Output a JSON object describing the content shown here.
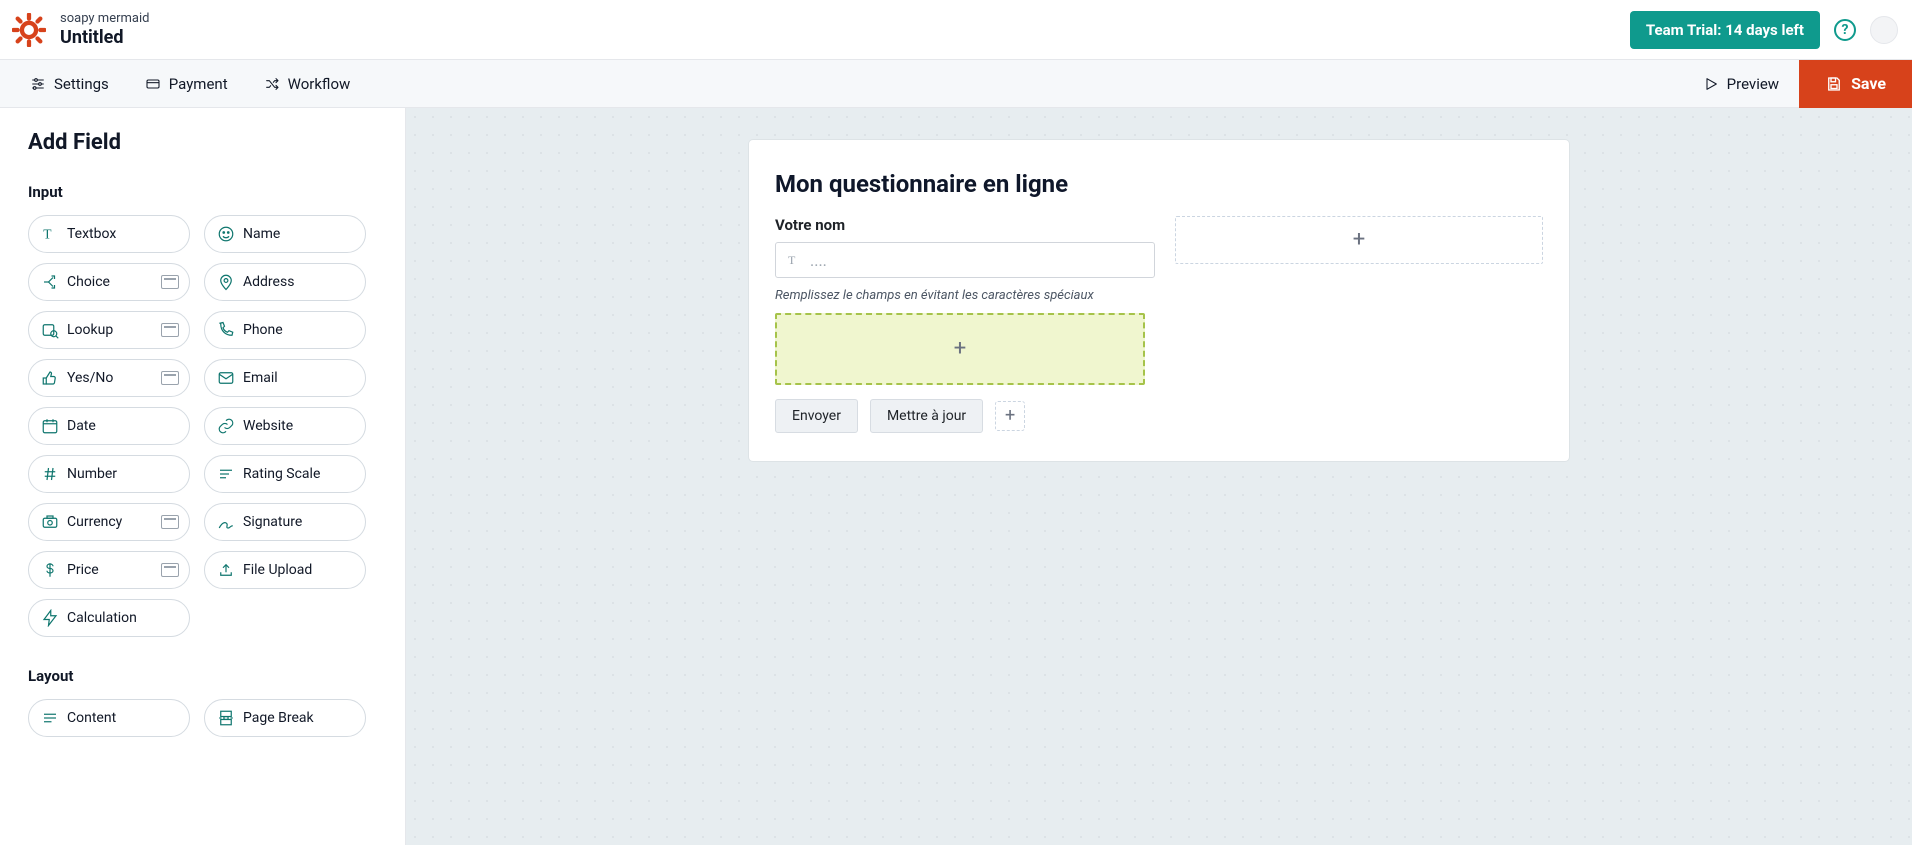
{
  "header": {
    "workspace": "soapy mermaid",
    "title": "Untitled",
    "trial_label": "Team Trial: 14 days left"
  },
  "toolbar": {
    "settings": "Settings",
    "payment": "Payment",
    "workflow": "Workflow",
    "preview": "Preview",
    "save": "Save"
  },
  "sidebar": {
    "heading": "Add Field",
    "group_input": "Input",
    "group_layout": "Layout",
    "fields": {
      "textbox": "Textbox",
      "name": "Name",
      "choice": "Choice",
      "address": "Address",
      "lookup": "Lookup",
      "phone": "Phone",
      "yesno": "Yes/No",
      "email": "Email",
      "date": "Date",
      "website": "Website",
      "number": "Number",
      "rating": "Rating Scale",
      "currency": "Currency",
      "signature": "Signature",
      "price": "Price",
      "fileupload": "File Upload",
      "calculation": "Calculation",
      "content": "Content",
      "pagebreak": "Page Break"
    }
  },
  "form": {
    "title": "Mon questionnaire en ligne",
    "field1_label": "Votre nom",
    "field1_placeholder": "....",
    "field1_hint": "Remplissez le champs en évitant les caractères spéciaux",
    "submit": "Envoyer",
    "update": "Mettre à jour"
  }
}
